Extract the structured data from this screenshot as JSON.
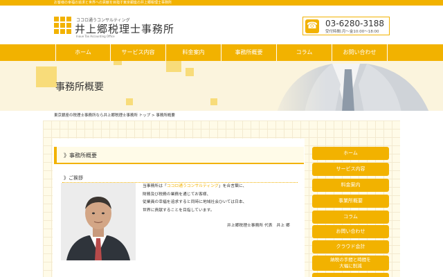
{
  "topbar": {
    "text": "お客様の幸福の追求と世界への貢献を目指す東京銀座の井上郷税理士事務所"
  },
  "logo": {
    "tagline": "ココロ通うコンサルティング",
    "name": "井上郷税理士事務所",
    "english": "Inoue Tax Accounting Office"
  },
  "contact": {
    "icon": "phone-icon",
    "tel": "03-6280-3188",
    "hours": "受付時間:月～金10:00～18:00"
  },
  "nav": {
    "items": [
      "ホーム",
      "サービス内容",
      "料金案内",
      "事務所概要",
      "コラム",
      "お問い合わせ"
    ]
  },
  "hero": {
    "title": "事務所概要"
  },
  "breadcrumb": {
    "text": "東京銀座の税理士事務所なら井上郷税理士事務所 トップ > 事務所概要"
  },
  "main": {
    "section_title": "》事務所概要",
    "greeting_title": "》ご挨拶",
    "greeting": {
      "line1_prefix": "当事務所は「",
      "line1_highlight": "ココロ通うコンサルティング",
      "line1_suffix": "」を合言葉に、",
      "line2": "財務及び税務の業務を通じてお客様、",
      "line3": "従業員の幸福を追求すると同時に地域社会ひいては日本、",
      "line4": "世界に貢献することを目指しています。"
    },
    "signature": "井上郷税理士事務所 代表　井上 郷"
  },
  "sidebar": {
    "items": [
      "ホーム",
      "サービス内容",
      "料金案内",
      "事業所概要",
      "コラム",
      "お問い合わせ",
      "クラウド会計"
    ],
    "item_two_line": [
      "納税の手間と時間を",
      "大幅に削減"
    ]
  },
  "colors": {
    "accent": "#f2b200",
    "hero_bg": "#fbf4dd",
    "content_bg": "#fffbe8"
  }
}
